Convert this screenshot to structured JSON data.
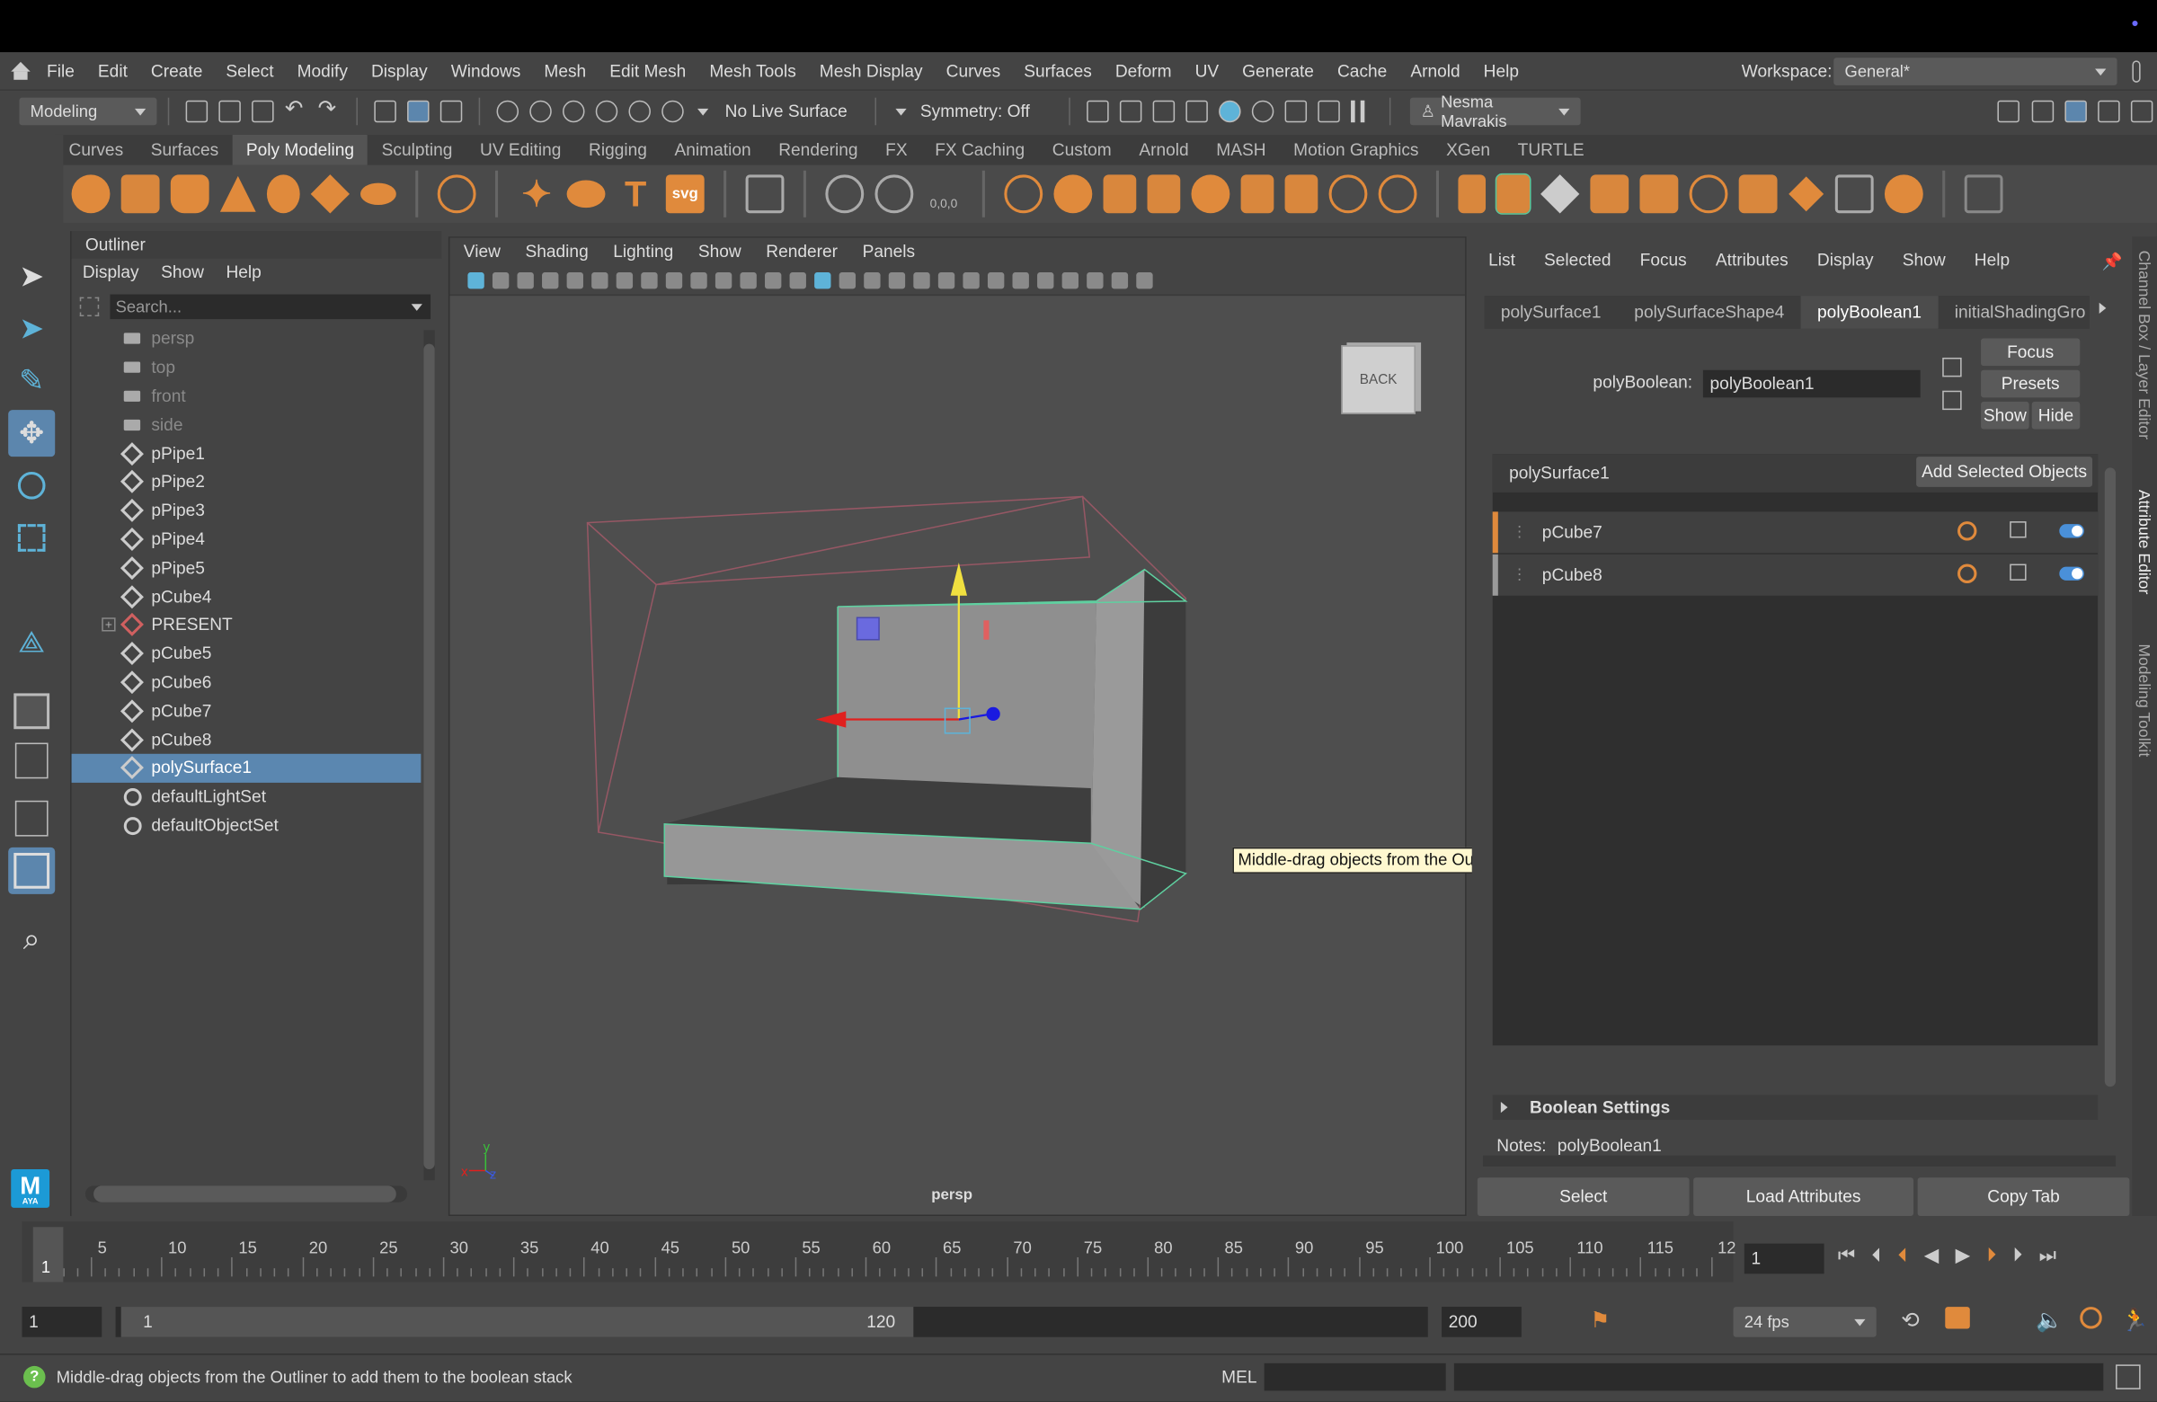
{
  "menubar": {
    "items": [
      "File",
      "Edit",
      "Create",
      "Select",
      "Modify",
      "Display",
      "Windows",
      "Mesh",
      "Edit Mesh",
      "Mesh Tools",
      "Mesh Display",
      "Curves",
      "Surfaces",
      "Deform",
      "UV",
      "Generate",
      "Cache",
      "Arnold",
      "Help"
    ],
    "workspace_label": "Workspace:",
    "workspace_value": "General*"
  },
  "statusline": {
    "mode": "Modeling",
    "live_surface": "No Live Surface",
    "symmetry": "Symmetry: Off",
    "user": "Nesma Mavrakis"
  },
  "shelf": {
    "tabs": [
      "Curves",
      "Surfaces",
      "Poly Modeling",
      "Sculpting",
      "UV Editing",
      "Rigging",
      "Animation",
      "Rendering",
      "FX",
      "FX Caching",
      "Custom",
      "Arnold",
      "MASH",
      "Motion Graphics",
      "XGen",
      "TURTLE"
    ],
    "active_tab": "Poly Modeling",
    "text_icon": "T",
    "svg_icon": "svg",
    "value_icon": "0,0,0"
  },
  "outliner": {
    "title": "Outliner",
    "menu": [
      "Display",
      "Show",
      "Help"
    ],
    "search_placeholder": "Search...",
    "items": [
      {
        "label": "persp",
        "icon": "camera-icon",
        "dim": true
      },
      {
        "label": "top",
        "icon": "camera-icon",
        "dim": true
      },
      {
        "label": "front",
        "icon": "camera-icon",
        "dim": true
      },
      {
        "label": "side",
        "icon": "camera-icon",
        "dim": true
      },
      {
        "label": "pPipe1",
        "icon": "mesh-icon"
      },
      {
        "label": "pPipe2",
        "icon": "mesh-icon"
      },
      {
        "label": "pPipe3",
        "icon": "mesh-icon"
      },
      {
        "label": "pPipe4",
        "icon": "mesh-icon"
      },
      {
        "label": "pPipe5",
        "icon": "mesh-icon"
      },
      {
        "label": "pCube4",
        "icon": "mesh-icon"
      },
      {
        "label": "PRESENT",
        "icon": "group-icon",
        "expand": true
      },
      {
        "label": "pCube5",
        "icon": "mesh-icon"
      },
      {
        "label": "pCube6",
        "icon": "mesh-icon"
      },
      {
        "label": "pCube7",
        "icon": "mesh-icon"
      },
      {
        "label": "pCube8",
        "icon": "mesh-icon"
      },
      {
        "label": "polySurface1",
        "icon": "mesh-icon",
        "selected": true
      },
      {
        "label": "defaultLightSet",
        "icon": "set-icon"
      },
      {
        "label": "defaultObjectSet",
        "icon": "set-icon"
      }
    ]
  },
  "viewport": {
    "menu": [
      "View",
      "Shading",
      "Lighting",
      "Show",
      "Renderer",
      "Panels"
    ],
    "camera_label": "persp",
    "viewcube_label": "BACK",
    "axis_x": "x",
    "axis_y": "y",
    "axis_z": "z",
    "tooltip": "Middle-drag objects from the Outliner to add them to the boolean stack"
  },
  "attribute_editor": {
    "menu": [
      "List",
      "Selected",
      "Focus",
      "Attributes",
      "Display",
      "Show",
      "Help"
    ],
    "tabs": [
      "polySurface1",
      "polySurfaceShape4",
      "polyBoolean1",
      "initialShadingGro"
    ],
    "active_tab": "polyBoolean1",
    "node_label": "polyBoolean:",
    "node_value": "polyBoolean1",
    "focus_button": "Focus",
    "presets_button": "Presets",
    "show_button": "Show",
    "hide_button": "Hide",
    "stack_title": "polySurface1",
    "add_selected_button": "Add Selected Objects",
    "stack_items": [
      {
        "label": "pCube7",
        "marker_color": "#e08a3c"
      },
      {
        "label": "pCube8",
        "marker_color": "#9a9a9a"
      }
    ],
    "section": "Boolean Settings",
    "notes_label": "Notes:",
    "notes_value": "polyBoolean1",
    "select_button": "Select",
    "load_button": "Load Attributes",
    "copy_button": "Copy Tab"
  },
  "side_tabs": [
    "Channel Box / Layer Editor",
    "Attribute Editor",
    "Modeling Toolkit"
  ],
  "time_slider": {
    "ticks": [
      "5",
      "10",
      "15",
      "20",
      "25",
      "30",
      "35",
      "40",
      "45",
      "50",
      "55",
      "60",
      "65",
      "70",
      "75",
      "80",
      "85",
      "90",
      "95",
      "100",
      "105",
      "110",
      "115",
      "12"
    ],
    "current_frame": "1",
    "current_frame_field": "1"
  },
  "range_slider": {
    "start": "1",
    "range_start": "1",
    "range_end": "120",
    "end": "200",
    "fps": "24 fps"
  },
  "command_line": {
    "help_text": "Middle-drag objects from the Outliner to add them to the boolean stack",
    "lang": "MEL"
  },
  "logo": {
    "text": "M",
    "sub": "AYA"
  },
  "colors": {
    "accent": "#5b87b0",
    "shelf_orange": "#e08a3c",
    "selection_green": "#5fd0a0",
    "manip_x": "#e0201e",
    "manip_y": "#f0e040",
    "manip_z": "#1a1ae0"
  }
}
